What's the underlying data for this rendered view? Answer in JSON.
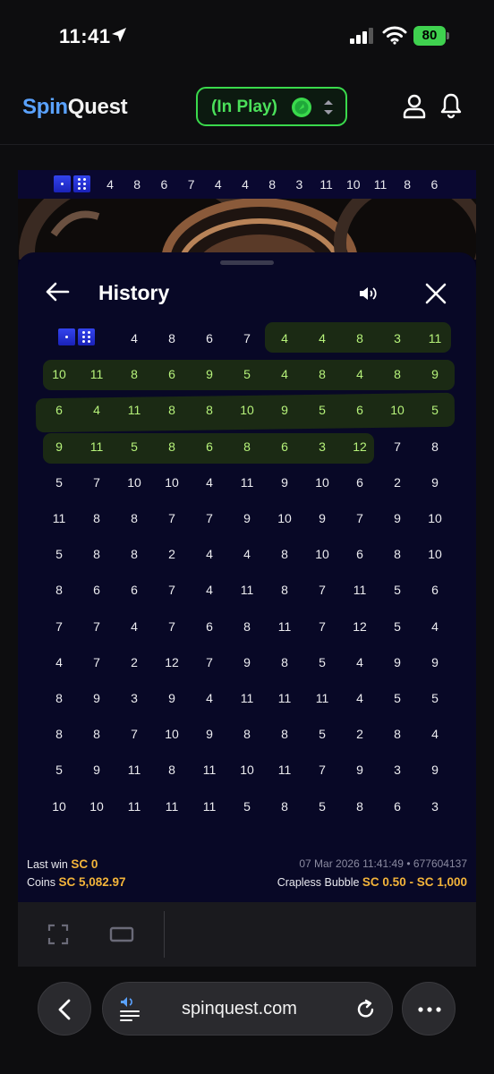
{
  "status": {
    "time": "11:41",
    "battery": "80"
  },
  "header": {
    "logo_spin": "Spin",
    "logo_quest": "Quest",
    "mode": "(In Play)"
  },
  "strip": {
    "results": [
      "4",
      "8",
      "6",
      "7",
      "4",
      "4",
      "8",
      "3",
      "11",
      "10",
      "11",
      "8",
      "6"
    ]
  },
  "history": {
    "title": "History",
    "rows": [
      [
        "DICE",
        "4",
        "8",
        "6",
        "7",
        "4",
        "4",
        "8",
        "3",
        "11"
      ],
      [
        "10",
        "11",
        "8",
        "6",
        "9",
        "5",
        "4",
        "8",
        "4",
        "8",
        "9"
      ],
      [
        "6",
        "4",
        "11",
        "8",
        "8",
        "10",
        "9",
        "5",
        "6",
        "10",
        "5"
      ],
      [
        "9",
        "11",
        "5",
        "8",
        "6",
        "8",
        "6",
        "3",
        "12",
        "7",
        "8"
      ],
      [
        "5",
        "7",
        "10",
        "10",
        "4",
        "11",
        "9",
        "10",
        "6",
        "2",
        "9"
      ],
      [
        "11",
        "8",
        "8",
        "7",
        "7",
        "9",
        "10",
        "9",
        "7",
        "9",
        "10"
      ],
      [
        "5",
        "8",
        "8",
        "2",
        "4",
        "4",
        "8",
        "10",
        "6",
        "8",
        "10"
      ],
      [
        "8",
        "6",
        "6",
        "7",
        "4",
        "11",
        "8",
        "7",
        "11",
        "5",
        "6"
      ],
      [
        "7",
        "7",
        "4",
        "7",
        "6",
        "8",
        "11",
        "7",
        "12",
        "5",
        "4"
      ],
      [
        "4",
        "7",
        "2",
        "12",
        "7",
        "9",
        "8",
        "5",
        "4",
        "9",
        "9"
      ],
      [
        "8",
        "9",
        "3",
        "9",
        "4",
        "11",
        "11",
        "11",
        "4",
        "5",
        "5"
      ],
      [
        "8",
        "8",
        "7",
        "10",
        "9",
        "8",
        "8",
        "5",
        "2",
        "8",
        "4"
      ],
      [
        "5",
        "9",
        "11",
        "8",
        "11",
        "10",
        "11",
        "7",
        "9",
        "3",
        "9"
      ],
      [
        "10",
        "10",
        "11",
        "11",
        "11",
        "5",
        "8",
        "5",
        "8",
        "6",
        "3"
      ]
    ]
  },
  "info": {
    "last_win_label": "Last win",
    "last_win_value": "SC 0",
    "coins_label": "Coins",
    "coins_value": "SC 5,082.97",
    "timestamp": "07 Mar 2026 11:41:49",
    "round_id": "• 677604137",
    "game_label": "Crapless Bubble",
    "limits": "SC 0.50 - SC 1,000"
  },
  "browser": {
    "url": "spinquest.com"
  },
  "colors": {
    "accent_green": "#3ad94c",
    "brand_blue": "#5aa2ff",
    "value_gold": "#f3b43a"
  }
}
